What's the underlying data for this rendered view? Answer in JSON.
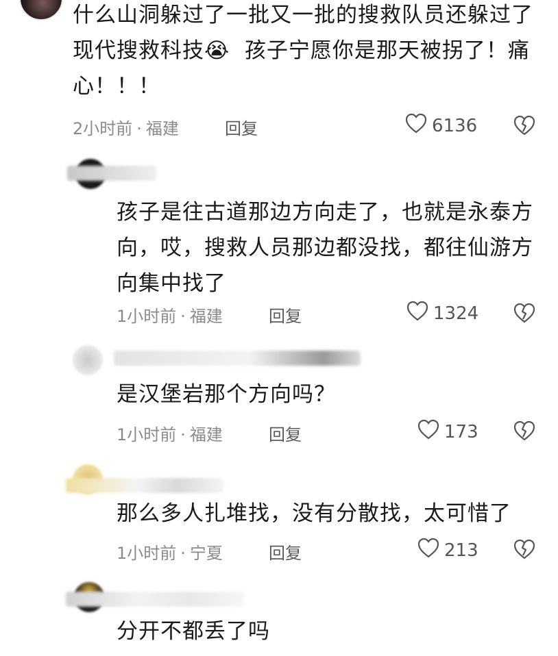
{
  "comments": [
    {
      "text": "什么山洞躲过了一批又一批的搜救队员还躲过了\n现代搜救科技😭  孩子宁愿你是那天被拐了！痛\n心！！！",
      "time": "2小时前",
      "location": "福建",
      "reply_label": "回复",
      "likes": "6136"
    },
    {
      "text": "孩子是往古道那边方向走了，也就是永泰方\n向，哎，搜救人员那边都没找，都往仙游方\n向集中找了",
      "time": "1小时前",
      "location": "福建",
      "reply_label": "回复",
      "likes": "1324"
    },
    {
      "text": "是汉堡岩那个方向吗？",
      "time": "1小时前",
      "location": "福建",
      "reply_label": "回复",
      "likes": "173"
    },
    {
      "text": "那么多人扎堆找，没有分散找，太可惜了",
      "time": "1小时前",
      "location": "宁夏",
      "reply_label": "回复",
      "likes": "213"
    },
    {
      "text": "分开不都丢了吗"
    }
  ],
  "meta_separator": "·",
  "icons": {
    "like": "heart-outline-icon",
    "dislike": "broken-heart-icon"
  },
  "colors": {
    "text": "#1a1a1a",
    "meta": "#8a8a8a",
    "icon": "#555555"
  }
}
